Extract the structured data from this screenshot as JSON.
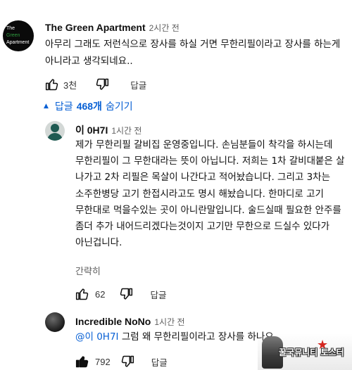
{
  "comments": [
    {
      "author": "The Green Apartment",
      "time": "2시간 전",
      "avatar_text": [
        "The",
        "Green",
        "Apartment"
      ],
      "text": "아무리 그래도 저런식으로 장사를 하실 거면 무한리필이라고 장사를 하는게 아니라고 생각되네요..",
      "likes": "3천",
      "reply_label": "답글"
    }
  ],
  "replies_toggle": {
    "prefix": "답글",
    "count": "468개",
    "suffix": "숨기기"
  },
  "replies": [
    {
      "author": "이 0H7I",
      "time": "1시간 전",
      "text": "제가 무한리필 갈비집 운영중입니다. 손님분들이 착각을 하시는데 무한리필이 그 무한대라는 뜻이 아닙니다. 저희는 1차 갈비대붙은 살 나가고 2차 리필은 목살이 나간다고 적어놨습니다. 그리고 3차는 소주한병당 고기 한접시라고도 명시 해놨습니다. 한마디로 고기 무한대로 먹을수있는 곳이 아니란말입니다. 술드실때 필요한 안주를 좀더 추가 내어드리겠다는것이지 고기만 무한으로 드실수 있다가 아닌겁니다.",
      "show_less": "간략히",
      "likes": "62",
      "reply_label": "답글"
    },
    {
      "author": "Incredible NoNo",
      "time": "1시간 전",
      "mention": "@이 0H7I",
      "text": " 그럼 왜 무한리필이라고 장사를 하나요",
      "likes": "792",
      "reply_label": "답글"
    }
  ],
  "watermark": {
    "text": "꿀국뮤니티 토스터"
  },
  "colors": {
    "link_blue": "#065fd4",
    "secondary_text": "#606060",
    "avatar_green": "#1f5a52"
  },
  "icons": [
    "thumbs-up-icon",
    "thumbs-down-icon",
    "chevron-up-icon"
  ]
}
